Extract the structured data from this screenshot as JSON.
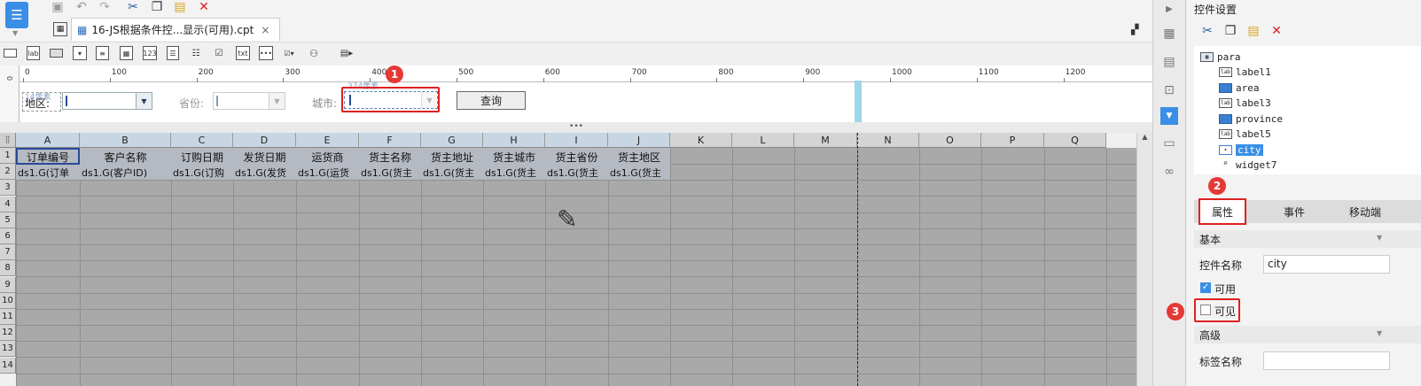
{
  "toolbar": {
    "tab_title": "16-JS根据条件控...显示(可用).cpt",
    "widget_icons": [
      "text-box-icon",
      "label-icon",
      "button-icon",
      "combo-icon",
      "list-icon",
      "date-icon",
      "number-icon",
      "textarea-icon",
      "checkbox-group-icon",
      "text-icon",
      "password-icon",
      "combo-check-icon",
      "tree-icon",
      "more-icon"
    ],
    "widget_labels": {
      "label": "lab",
      "number": "123",
      "text": "txt"
    }
  },
  "ruler": {
    "ticks": [
      "0",
      "100",
      "200",
      "300",
      "400",
      "500",
      "600",
      "700",
      "800",
      "900",
      "1000",
      "1100",
      "1200"
    ],
    "vertical_zero": "0"
  },
  "param_panel": {
    "area_label": "地区:",
    "province_label": "省份:",
    "city_label": "城市:",
    "query_button": "查询",
    "dim_hint_left": "14像素",
    "dim_hint_top": "374像素"
  },
  "sheet": {
    "columns": [
      "A",
      "B",
      "C",
      "D",
      "E",
      "F",
      "G",
      "H",
      "I",
      "J",
      "K",
      "L",
      "M",
      "N",
      "O",
      "P",
      "Q"
    ],
    "rows": [
      "1",
      "2",
      "3",
      "4",
      "5",
      "6",
      "7",
      "8",
      "9",
      "10",
      "11",
      "12",
      "13",
      "14"
    ],
    "header_cells": [
      "订单编号",
      "客户名称",
      "订购日期",
      "发货日期",
      "运货商",
      "货主名称",
      "货主地址",
      "货主城市",
      "货主省份",
      "货主地区"
    ],
    "data_cells": [
      "ds1.G(订单",
      "ds1.G(客户ID)",
      "ds1.G(订购",
      "ds1.G(发货",
      "ds1.G(运货",
      "ds1.G(货主",
      "ds1.G(货主",
      "ds1.G(货主",
      "ds1.G(货主",
      "ds1.G(货主"
    ]
  },
  "right_panel": {
    "title": "控件设置",
    "tree": [
      "para",
      "label1",
      "area",
      "label3",
      "province",
      "label5",
      "city",
      "widget7"
    ],
    "tabs": [
      "属性",
      "事件",
      "移动端"
    ],
    "section_basic": "基本",
    "field_name_label": "控件名称",
    "field_name_value": "city",
    "enabled_label": "可用",
    "visible_label": "可见",
    "section_advanced": "高级",
    "tag_name_label": "标签名称"
  },
  "callouts": [
    "1",
    "2",
    "3"
  ],
  "colors": {
    "accent": "#3a7fd0",
    "callout": "#e53935"
  }
}
